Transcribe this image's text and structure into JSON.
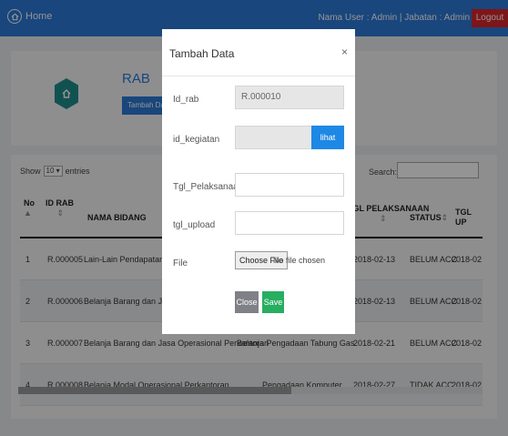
{
  "navbar": {
    "home_label": "Home",
    "user_text": "Nama User : Admin | Jabatan : Admin",
    "logout_label": "Logout"
  },
  "header": {
    "title": "RAB",
    "add_button_label": "Tambah Data"
  },
  "table_controls": {
    "show_label": "Show",
    "entries_value": "10",
    "entries_label": "entries",
    "search_label": "Search:",
    "search_value": ""
  },
  "table": {
    "columns": {
      "no": "No",
      "id_rab": "ID RAB",
      "nama_bidang": "NAMA BIDANG",
      "tgl_pelaksanaan": "TGL PELAKSANAAN",
      "status": "STATUS",
      "tgl_upload": "TGL UP"
    },
    "rows": [
      {
        "no": "1",
        "id_rab": "R.000005",
        "nama_bidang": "Lain-Lain Pendapatan Desa Yang Sah",
        "kegiatan": "",
        "tgl": "2018-02-13",
        "status": "BELUM ACC",
        "upload": "2018-02"
      },
      {
        "no": "2",
        "id_rab": "R.000006",
        "nama_bidang": "Belanja Barang dan Jasa Operasional Perkantoran",
        "kegiatan": "",
        "tgl": "2018-02-13",
        "status": "BELUM ACC",
        "upload": "2018-02"
      },
      {
        "no": "3",
        "id_rab": "R.000007",
        "nama_bidang": "Belanja Barang dan Jasa Operasional Perkantoran",
        "kegiatan": "Belanja Pengadaan Tabung Gas",
        "tgl": "2018-02-21",
        "status": "BELUM ACC",
        "upload": "2018-02"
      },
      {
        "no": "4",
        "id_rab": "R.000008",
        "nama_bidang": "Belanja Modal Operasional Perkantoran",
        "kegiatan": "Pengadaan Komputer",
        "tgl": "2018-02-27",
        "status": "TIDAK ACC",
        "upload": "2018-02"
      }
    ]
  },
  "modal": {
    "title": "Tambah Data",
    "close_symbol": "×",
    "id_rab_label": "Id_rab",
    "id_rab_value": "R.000010",
    "id_kegiatan_label": "id_kegiatan",
    "lihat_button_label": "lihat Data",
    "tgl_pelaksanaan_label": "Tgl_Pelaksanaan",
    "tgl_upload_label": "tgl_upload",
    "file_label": "File",
    "choose_file_label": "Choose File",
    "file_status": "No file chosen",
    "close_button_label": "Close",
    "save_button_label": "Save"
  }
}
